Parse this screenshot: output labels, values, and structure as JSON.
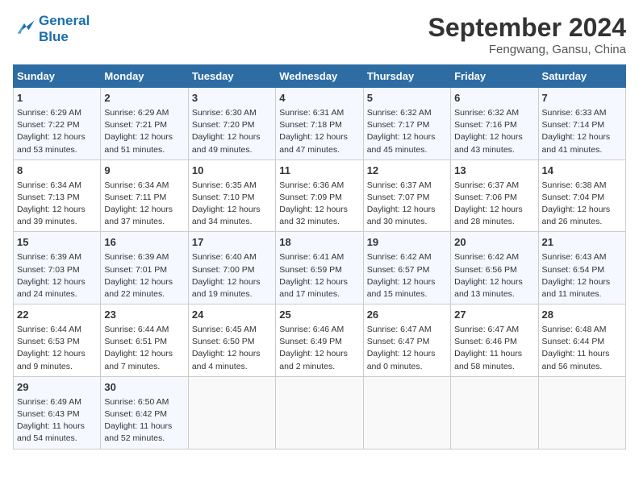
{
  "header": {
    "logo_line1": "General",
    "logo_line2": "Blue",
    "month": "September 2024",
    "location": "Fengwang, Gansu, China"
  },
  "days_of_week": [
    "Sunday",
    "Monday",
    "Tuesday",
    "Wednesday",
    "Thursday",
    "Friday",
    "Saturday"
  ],
  "weeks": [
    [
      {
        "day": 1,
        "info": "Sunrise: 6:29 AM\nSunset: 7:22 PM\nDaylight: 12 hours\nand 53 minutes."
      },
      {
        "day": 2,
        "info": "Sunrise: 6:29 AM\nSunset: 7:21 PM\nDaylight: 12 hours\nand 51 minutes."
      },
      {
        "day": 3,
        "info": "Sunrise: 6:30 AM\nSunset: 7:20 PM\nDaylight: 12 hours\nand 49 minutes."
      },
      {
        "day": 4,
        "info": "Sunrise: 6:31 AM\nSunset: 7:18 PM\nDaylight: 12 hours\nand 47 minutes."
      },
      {
        "day": 5,
        "info": "Sunrise: 6:32 AM\nSunset: 7:17 PM\nDaylight: 12 hours\nand 45 minutes."
      },
      {
        "day": 6,
        "info": "Sunrise: 6:32 AM\nSunset: 7:16 PM\nDaylight: 12 hours\nand 43 minutes."
      },
      {
        "day": 7,
        "info": "Sunrise: 6:33 AM\nSunset: 7:14 PM\nDaylight: 12 hours\nand 41 minutes."
      }
    ],
    [
      {
        "day": 8,
        "info": "Sunrise: 6:34 AM\nSunset: 7:13 PM\nDaylight: 12 hours\nand 39 minutes."
      },
      {
        "day": 9,
        "info": "Sunrise: 6:34 AM\nSunset: 7:11 PM\nDaylight: 12 hours\nand 37 minutes."
      },
      {
        "day": 10,
        "info": "Sunrise: 6:35 AM\nSunset: 7:10 PM\nDaylight: 12 hours\nand 34 minutes."
      },
      {
        "day": 11,
        "info": "Sunrise: 6:36 AM\nSunset: 7:09 PM\nDaylight: 12 hours\nand 32 minutes."
      },
      {
        "day": 12,
        "info": "Sunrise: 6:37 AM\nSunset: 7:07 PM\nDaylight: 12 hours\nand 30 minutes."
      },
      {
        "day": 13,
        "info": "Sunrise: 6:37 AM\nSunset: 7:06 PM\nDaylight: 12 hours\nand 28 minutes."
      },
      {
        "day": 14,
        "info": "Sunrise: 6:38 AM\nSunset: 7:04 PM\nDaylight: 12 hours\nand 26 minutes."
      }
    ],
    [
      {
        "day": 15,
        "info": "Sunrise: 6:39 AM\nSunset: 7:03 PM\nDaylight: 12 hours\nand 24 minutes."
      },
      {
        "day": 16,
        "info": "Sunrise: 6:39 AM\nSunset: 7:01 PM\nDaylight: 12 hours\nand 22 minutes."
      },
      {
        "day": 17,
        "info": "Sunrise: 6:40 AM\nSunset: 7:00 PM\nDaylight: 12 hours\nand 19 minutes."
      },
      {
        "day": 18,
        "info": "Sunrise: 6:41 AM\nSunset: 6:59 PM\nDaylight: 12 hours\nand 17 minutes."
      },
      {
        "day": 19,
        "info": "Sunrise: 6:42 AM\nSunset: 6:57 PM\nDaylight: 12 hours\nand 15 minutes."
      },
      {
        "day": 20,
        "info": "Sunrise: 6:42 AM\nSunset: 6:56 PM\nDaylight: 12 hours\nand 13 minutes."
      },
      {
        "day": 21,
        "info": "Sunrise: 6:43 AM\nSunset: 6:54 PM\nDaylight: 12 hours\nand 11 minutes."
      }
    ],
    [
      {
        "day": 22,
        "info": "Sunrise: 6:44 AM\nSunset: 6:53 PM\nDaylight: 12 hours\nand 9 minutes."
      },
      {
        "day": 23,
        "info": "Sunrise: 6:44 AM\nSunset: 6:51 PM\nDaylight: 12 hours\nand 7 minutes."
      },
      {
        "day": 24,
        "info": "Sunrise: 6:45 AM\nSunset: 6:50 PM\nDaylight: 12 hours\nand 4 minutes."
      },
      {
        "day": 25,
        "info": "Sunrise: 6:46 AM\nSunset: 6:49 PM\nDaylight: 12 hours\nand 2 minutes."
      },
      {
        "day": 26,
        "info": "Sunrise: 6:47 AM\nSunset: 6:47 PM\nDaylight: 12 hours\nand 0 minutes."
      },
      {
        "day": 27,
        "info": "Sunrise: 6:47 AM\nSunset: 6:46 PM\nDaylight: 11 hours\nand 58 minutes."
      },
      {
        "day": 28,
        "info": "Sunrise: 6:48 AM\nSunset: 6:44 PM\nDaylight: 11 hours\nand 56 minutes."
      }
    ],
    [
      {
        "day": 29,
        "info": "Sunrise: 6:49 AM\nSunset: 6:43 PM\nDaylight: 11 hours\nand 54 minutes."
      },
      {
        "day": 30,
        "info": "Sunrise: 6:50 AM\nSunset: 6:42 PM\nDaylight: 11 hours\nand 52 minutes."
      },
      {
        "day": null,
        "info": ""
      },
      {
        "day": null,
        "info": ""
      },
      {
        "day": null,
        "info": ""
      },
      {
        "day": null,
        "info": ""
      },
      {
        "day": null,
        "info": ""
      }
    ]
  ]
}
